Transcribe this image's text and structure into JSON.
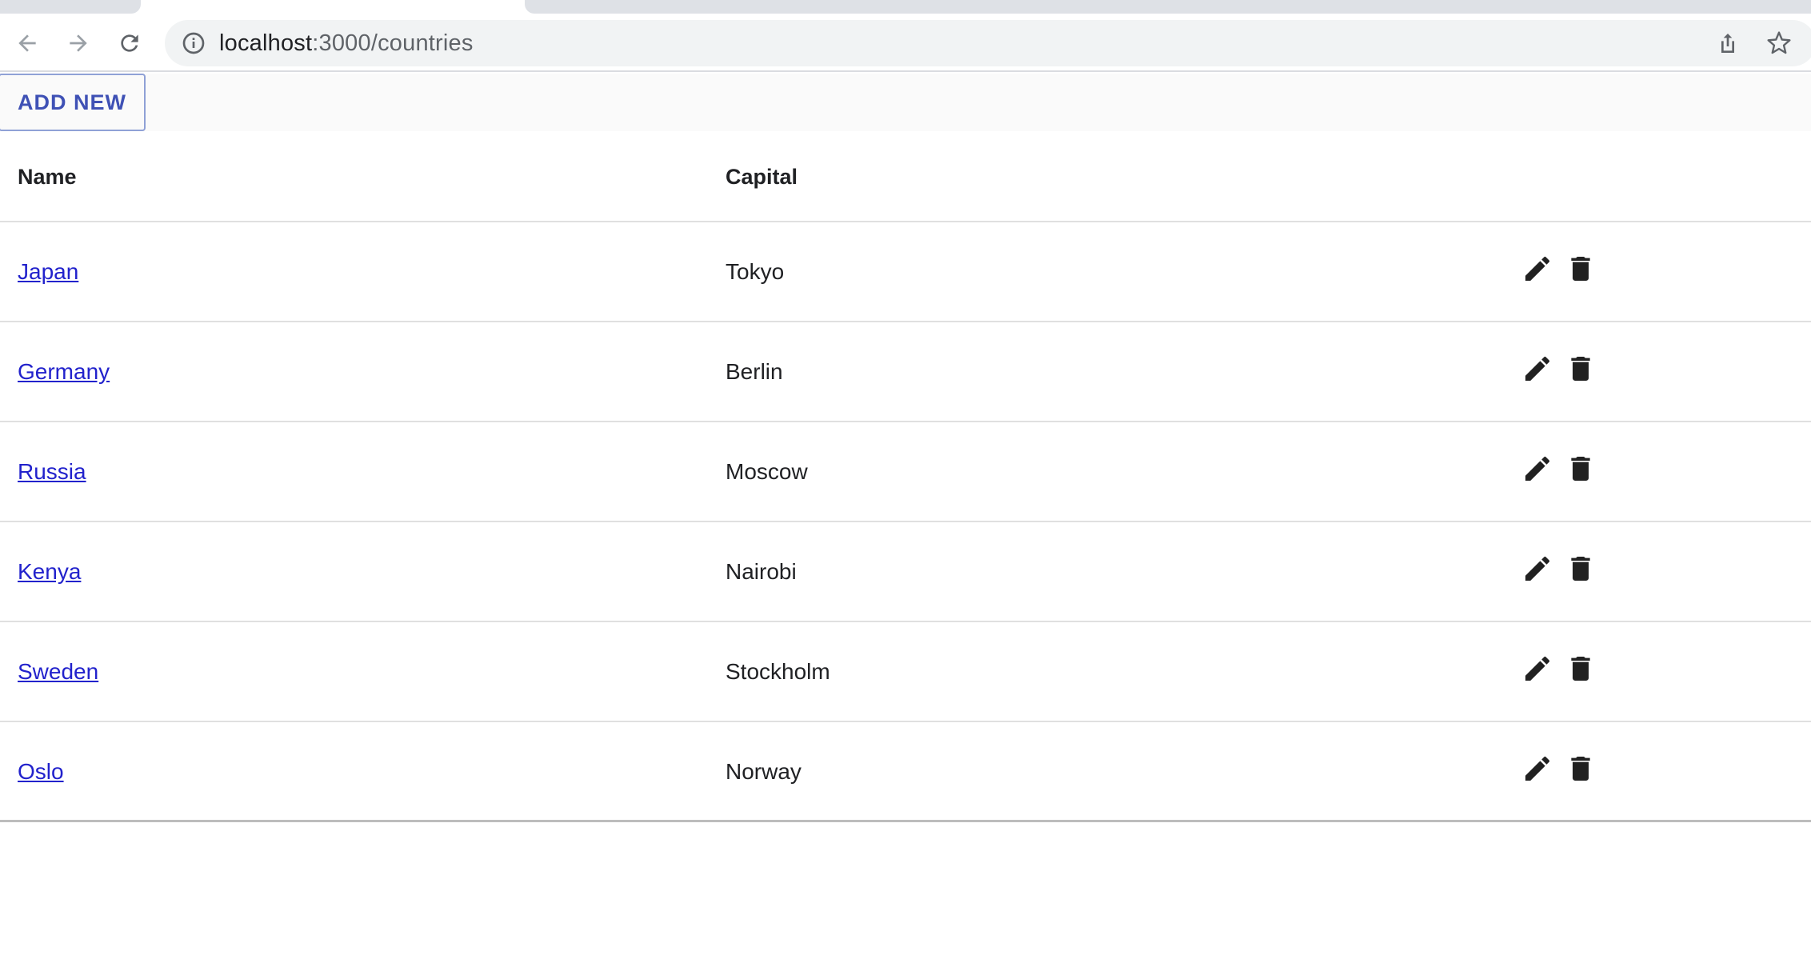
{
  "browser": {
    "url_host": "localhost",
    "url_path": ":3000/countries"
  },
  "toolbar": {
    "add_new_label": "ADD NEW"
  },
  "table": {
    "headers": {
      "name": "Name",
      "capital": "Capital"
    },
    "rows": [
      {
        "name": "Japan",
        "capital": "Tokyo"
      },
      {
        "name": "Germany",
        "capital": "Berlin"
      },
      {
        "name": "Russia",
        "capital": "Moscow"
      },
      {
        "name": "Kenya",
        "capital": "Nairobi"
      },
      {
        "name": "Sweden",
        "capital": "Stockholm"
      },
      {
        "name": "Oslo",
        "capital": "Norway"
      }
    ]
  },
  "colors": {
    "accent": "#3f51b5",
    "link": "#2222cc"
  },
  "icons": {
    "edit": "pencil-icon",
    "delete": "trash-icon"
  }
}
